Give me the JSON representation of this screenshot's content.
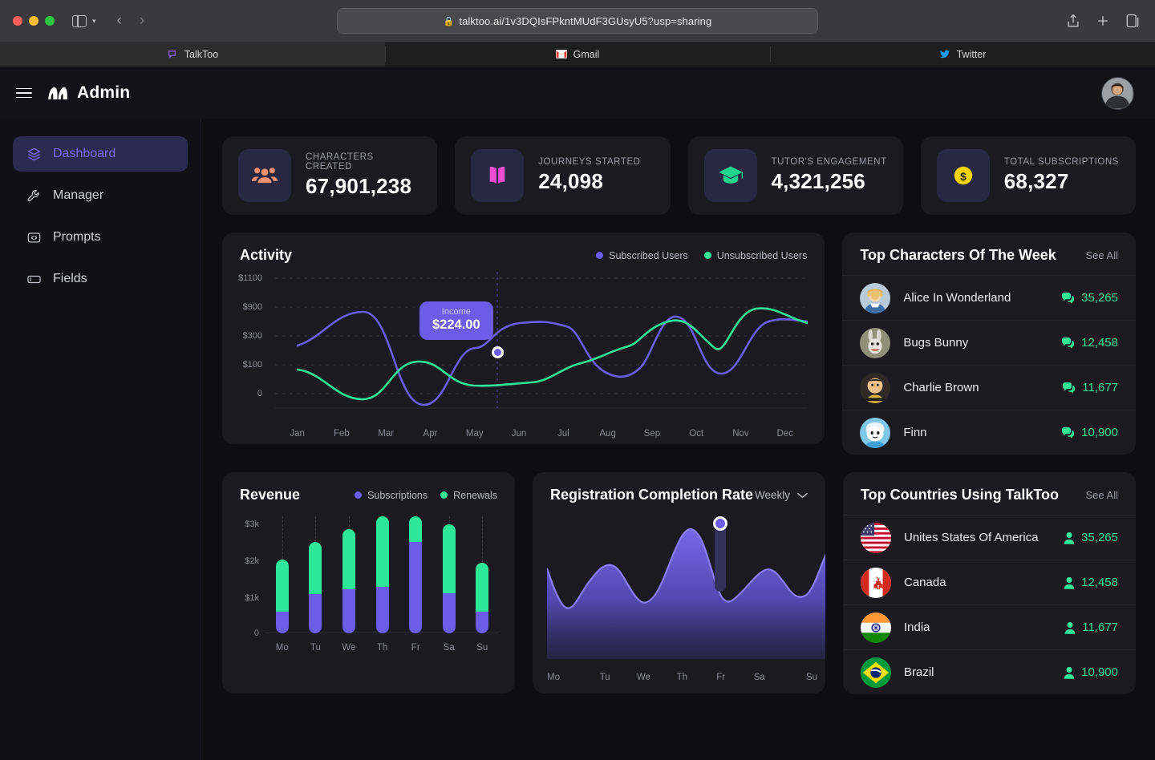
{
  "browser": {
    "url": "talktoo.ai/1v3DQIsFPkntMUdF3GUsyU5?usp=sharing",
    "lock_icon": "lock-icon",
    "tabs": [
      {
        "label": "TalkToo",
        "favicon": "talktoo-chat-bubble-icon",
        "active": true
      },
      {
        "label": "Gmail",
        "favicon": "gmail-icon",
        "active": false
      },
      {
        "label": "Twitter",
        "favicon": "twitter-bird-icon",
        "active": false
      }
    ]
  },
  "header": {
    "menu_icon": "hamburger-icon",
    "logo_icon": "talktoo-logo-icon",
    "title": "Admin",
    "avatar_icon": "user-avatar"
  },
  "sidebar": {
    "items": [
      {
        "label": "Dashboard",
        "icon": "layers-icon",
        "active": true
      },
      {
        "label": "Manager",
        "icon": "wrench-icon",
        "active": false
      },
      {
        "label": "Prompts",
        "icon": "code-brackets-icon",
        "active": false
      },
      {
        "label": "Fields",
        "icon": "input-field-icon",
        "active": false
      }
    ]
  },
  "stats": [
    {
      "label": "CHARACTERS CREATED",
      "value": "67,901,238",
      "icon": "people-group-icon",
      "color": "#f08f6e"
    },
    {
      "label": "JOURNEYS STARTED",
      "value": "24,098",
      "icon": "open-book-icon",
      "color": "#ef4cd6"
    },
    {
      "label": "TUTOR'S ENGAGEMENT",
      "value": "4,321,256",
      "icon": "graduation-cap-icon",
      "color": "#1fd68e"
    },
    {
      "label": "TOTAL SUBSCRIPTIONS",
      "value": "68,327",
      "icon": "dollar-coin-icon",
      "color": "#f5d400"
    }
  ],
  "activity": {
    "title": "Activity",
    "legend": [
      {
        "label": "Subscribed Users",
        "color": "#6c5ce7"
      },
      {
        "label": "Unsubscribed Users",
        "color": "#2ee89a"
      }
    ],
    "tooltip": {
      "label": "Income",
      "value": "$224.00"
    }
  },
  "revenue": {
    "title": "Revenue",
    "legend": [
      {
        "label": "Subscriptions",
        "color": "#6c5ce7"
      },
      {
        "label": "Renewals",
        "color": "#2ee89a"
      }
    ]
  },
  "registration": {
    "title": "Registration Completion Rate",
    "period": "Weekly",
    "chevron_icon": "chevron-down-icon"
  },
  "top_characters": {
    "title": "Top Characters Of The Week",
    "see_all": "See All",
    "rows": [
      {
        "name": "Alice In Wonderland",
        "count": "35,265",
        "icon": "chat-bubbles-icon"
      },
      {
        "name": "Bugs Bunny",
        "count": "12,458",
        "icon": "chat-bubbles-icon"
      },
      {
        "name": "Charlie Brown",
        "count": "11,677",
        "icon": "chat-bubbles-icon"
      },
      {
        "name": "Finn",
        "count": "10,900",
        "icon": "chat-bubbles-icon"
      }
    ]
  },
  "top_countries": {
    "title": "Top Countries Using TalkToo",
    "see_all": "See All",
    "rows": [
      {
        "name": "Unites States Of America",
        "count": "35,265",
        "icon": "user-icon",
        "flag": "us-flag"
      },
      {
        "name": "Canada",
        "count": "12,458",
        "icon": "user-icon",
        "flag": "canada-flag"
      },
      {
        "name": "India",
        "count": "11,677",
        "icon": "user-icon",
        "flag": "india-flag"
      },
      {
        "name": "Brazil",
        "count": "10,900",
        "icon": "user-icon",
        "flag": "brazil-flag"
      }
    ]
  },
  "chart_data": [
    {
      "type": "line",
      "title": "Activity",
      "xlabel": "",
      "ylabel": "",
      "x": [
        "Jan",
        "Feb",
        "Mar",
        "Apr",
        "May",
        "Jun",
        "Jul",
        "Aug",
        "Sep",
        "Oct",
        "Nov",
        "Dec"
      ],
      "ytick_labels": [
        "$1100",
        "$900",
        "$300",
        "$100",
        "0"
      ],
      "ytick_values": [
        1100,
        900,
        300,
        100,
        0
      ],
      "ylim": [
        -80,
        1180
      ],
      "grid": true,
      "legend_position": "top-right",
      "series": [
        {
          "name": "Subscribed Users",
          "color": "#6c5ce7",
          "values": [
            290,
            760,
            420,
            0,
            170,
            400,
            380,
            300,
            224,
            90,
            590,
            300
          ]
        },
        {
          "name": "Unsubscribed Users",
          "color": "#2ee89a",
          "values": [
            150,
            10,
            130,
            230,
            70,
            80,
            140,
            260,
            470,
            350,
            480,
            800
          ]
        }
      ],
      "annotation": {
        "label": "Income",
        "value": "$224.00",
        "at_x": "Sep"
      }
    },
    {
      "type": "bar",
      "title": "Revenue",
      "stacked": true,
      "categories": [
        "Mo",
        "Tu",
        "We",
        "Th",
        "Fr",
        "Sa",
        "Su"
      ],
      "ytick_labels": [
        "$3k",
        "$2k",
        "$1k",
        "0"
      ],
      "ytick_values": [
        3000,
        2000,
        1000,
        0
      ],
      "ylim": [
        0,
        3000
      ],
      "grid": true,
      "legend_position": "top-right",
      "series": [
        {
          "name": "Subscriptions",
          "color": "#6c5ce7",
          "values": [
            400,
            750,
            850,
            1000,
            1950,
            780,
            420
          ]
        },
        {
          "name": "Renewals",
          "color": "#2ee89a",
          "values": [
            1000,
            1000,
            1150,
            1500,
            550,
            1320,
            930
          ]
        }
      ]
    },
    {
      "type": "area",
      "title": "Registration Completion Rate",
      "period": "Weekly",
      "categories": [
        "Mo",
        "Tu",
        "We",
        "Th",
        "Fr",
        "Sa",
        "Su"
      ],
      "grid": false,
      "series": [
        {
          "name": "Registration Completion Rate",
          "color": "#6c5ce7",
          "values": [
            62,
            28,
            70,
            42,
            100,
            44,
            72,
            96
          ]
        }
      ],
      "highlight": {
        "category": "Fr",
        "marker": true
      }
    }
  ]
}
